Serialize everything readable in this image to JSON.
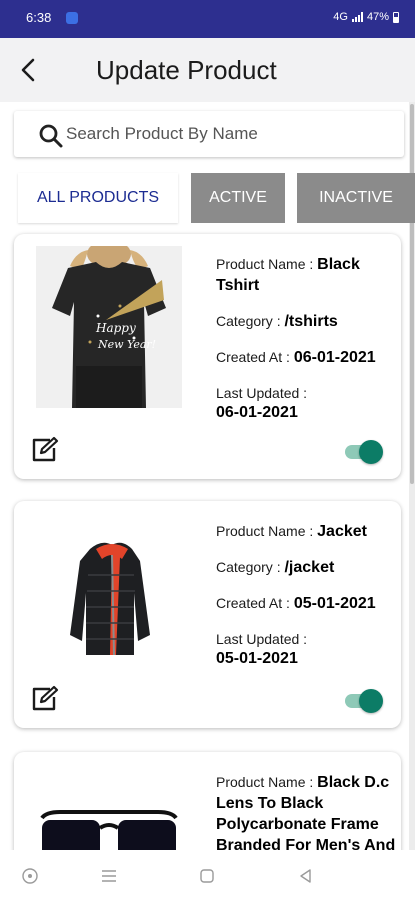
{
  "status_bar": {
    "time": "6:38",
    "network": "4G",
    "battery": "47%"
  },
  "header": {
    "title": "Update Product",
    "back_icon": "arrow-left-icon"
  },
  "search": {
    "placeholder": "Search Product By Name",
    "value": ""
  },
  "tabs": [
    {
      "label": "ALL PRODUCTS",
      "selected": true
    },
    {
      "label": "ACTIVE",
      "selected": false
    },
    {
      "label": "INACTIVE",
      "selected": false
    }
  ],
  "products": [
    {
      "name_label": "Product Name : ",
      "name": "Black Tshirt",
      "category_label": "Category : ",
      "category": "/tshirts",
      "created_label": "Created At : ",
      "created": "06-01-2021",
      "updated_label": "Last Updated : ",
      "updated": "06-01-2021",
      "image_text": [
        "Happy",
        "New Year!"
      ],
      "active": true
    },
    {
      "name_label": "Product Name : ",
      "name": "Jacket",
      "category_label": "Category : ",
      "category": "/jacket",
      "created_label": "Created At : ",
      "created": "05-01-2021",
      "updated_label": "Last Updated : ",
      "updated": "05-01-2021",
      "active": true
    },
    {
      "name_label": "Product Name : ",
      "name": "Black D.c Lens To Black Polycarbonate Frame Branded For Men's And"
    }
  ],
  "colors": {
    "accent": "#1c2c92",
    "status_bar": "#2d2f8f",
    "toggle_on": "#0c7c66",
    "tab_inactive": "#8b8b8b"
  }
}
